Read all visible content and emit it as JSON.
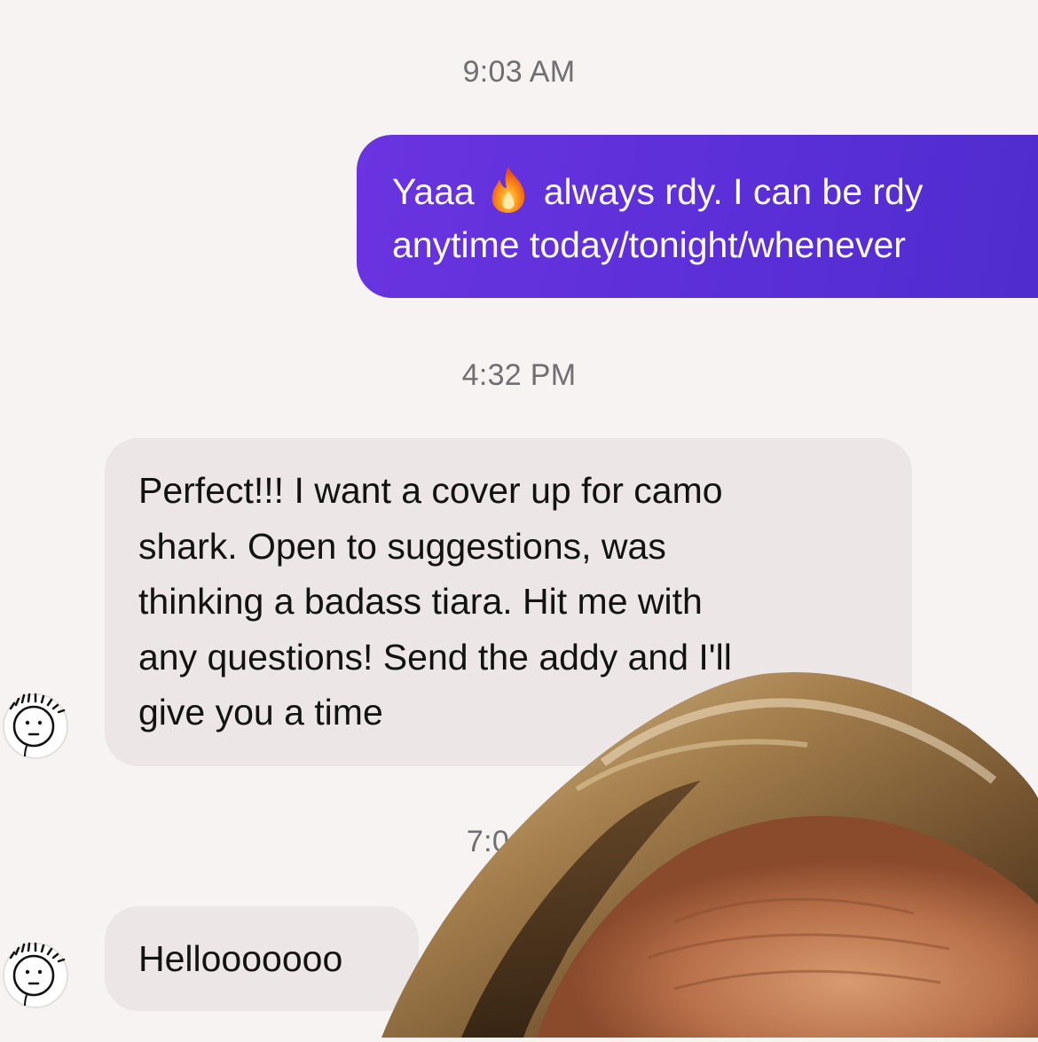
{
  "thread": {
    "timestamps": [
      "9:03 AM",
      "4:32 PM",
      "7:0"
    ],
    "outgoing": {
      "line1_before": "Yaaa",
      "line1_after": "always rdy. I can be rdy",
      "line2": "anytime today/tonight/whenever",
      "emoji": "fire-emoji"
    },
    "incoming_1": {
      "lines": [
        "Perfect!!! I want a cover up for camo",
        "shark. Open to suggestions, was",
        "thinking a badass tiara. Hit me with",
        "any questions! Send the addy and I'll",
        "give you a time"
      ]
    },
    "incoming_2": {
      "text": "Hellooooooo"
    }
  },
  "colors": {
    "background": "#f8f3f3",
    "outgoing_bubble": "#5b2fd8",
    "incoming_bubble": "#ece6e6",
    "timestamp": "#6f6f72"
  },
  "icons": {
    "avatar": "doodle-face-avatar-icon",
    "overlay": "person-photo-overlay"
  }
}
